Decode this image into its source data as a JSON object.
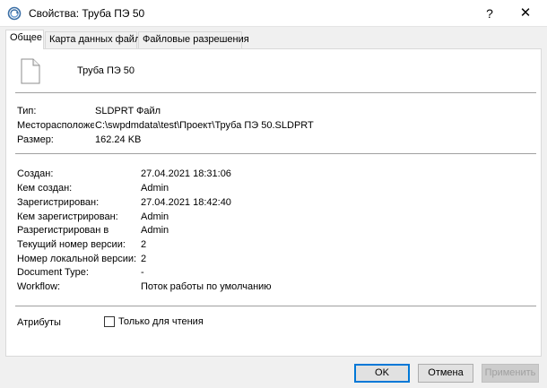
{
  "window": {
    "title": "Свойства: Труба ПЭ 50",
    "help_label": "?",
    "close_label": "✕"
  },
  "tabs": [
    {
      "label": "Общее",
      "active": true
    },
    {
      "label": "Карта данных файла",
      "active": false
    },
    {
      "label": "Файловые разрешения",
      "active": false
    }
  ],
  "file": {
    "name": "Труба ПЭ 50",
    "type_label": "Тип:",
    "type_value": "SLDPRT Файл",
    "location_label": "Месторасположен",
    "location_value": "C:\\swpdmdata\\test\\Проект\\Труба ПЭ 50.SLDPRT",
    "size_label": "Размер:",
    "size_value": "162.24 KB"
  },
  "details": [
    {
      "label": "Создан:",
      "value": "27.04.2021 18:31:06"
    },
    {
      "label": "Кем создан:",
      "value": "Admin"
    },
    {
      "label": "Зарегистрирован:",
      "value": "27.04.2021 18:42:40"
    },
    {
      "label": "Кем зарегистрирован:",
      "value": "Admin"
    },
    {
      "label": "Разрегистрирован в",
      "value": "Admin"
    },
    {
      "label": "Текущий номер версии:",
      "value": "2"
    },
    {
      "label": "Номер локальной версии:",
      "value": "2"
    },
    {
      "label": "Document Type:",
      "value": "-"
    },
    {
      "label": "Workflow:",
      "value": "Поток работы по умолчанию"
    }
  ],
  "attributes": {
    "label": "Атрибуты",
    "readonly_label": "Только для чтения",
    "readonly_checked": false
  },
  "buttons": {
    "ok": "OK",
    "cancel": "Отмена",
    "apply": "Применить"
  },
  "colors": {
    "window_bg": "#f0f0f0",
    "panel_bg": "#ffffff",
    "default_button_border": "#0078d7"
  },
  "icons": {
    "app": "properties-icon",
    "file": "document-icon"
  }
}
